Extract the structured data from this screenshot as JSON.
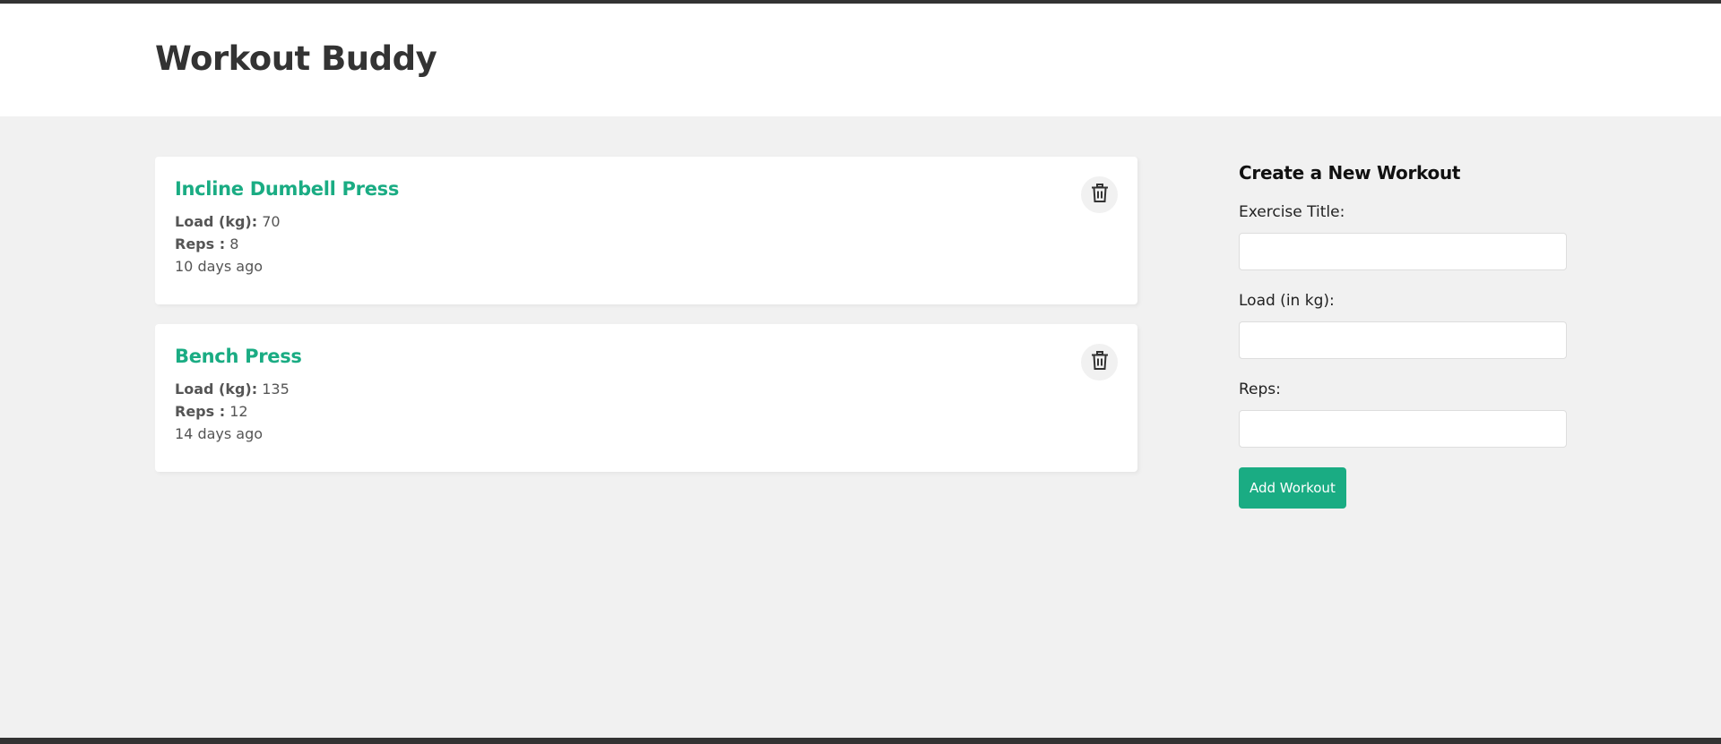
{
  "header": {
    "title": "Workout Buddy"
  },
  "workouts": [
    {
      "title": "Incline Dumbell Press",
      "load_label": "Load (kg):",
      "load_value": "70",
      "reps_label": "Reps :",
      "reps_value": "8",
      "time": "10 days ago",
      "delete_icon": "trash-icon"
    },
    {
      "title": "Bench Press",
      "load_label": "Load (kg):",
      "load_value": "135",
      "reps_label": "Reps :",
      "reps_value": "12",
      "time": "14 days ago",
      "delete_icon": "trash-icon"
    }
  ],
  "form": {
    "title": "Create a New Workout",
    "fields": [
      {
        "label": "Exercise Title:",
        "value": ""
      },
      {
        "label": "Load (in kg):",
        "value": ""
      },
      {
        "label": "Reps:",
        "value": ""
      }
    ],
    "submit_label": "Add Workout"
  },
  "colors": {
    "accent": "#1aac83",
    "background": "#f1f1f1",
    "dark": "#333333"
  }
}
